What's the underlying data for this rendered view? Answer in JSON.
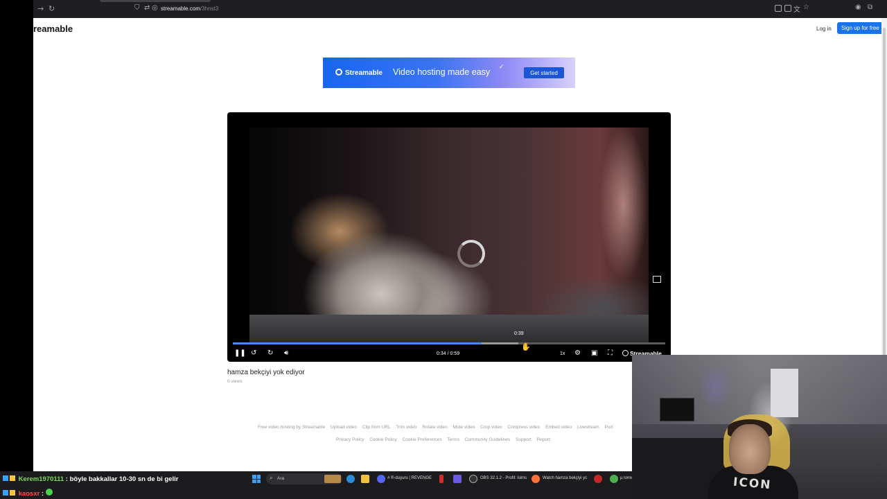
{
  "browser": {
    "url_host": "streamable.com",
    "url_path": "/3hnst3"
  },
  "header": {
    "logo": "reamable",
    "login": "Log in",
    "signup": "Sign up for free"
  },
  "banner": {
    "brand": "Streamable",
    "tagline": "Video hosting made easy",
    "cta": "Get started"
  },
  "player": {
    "hover_time": "0:39",
    "time_display": "0:34 / 0:59",
    "speed": "1x",
    "brand": "Streamable",
    "played_fraction": 0.576,
    "buffered_fraction": 0.661
  },
  "video": {
    "title": "hamza bekçiyi yok ediyor",
    "views": "0 views"
  },
  "footer": {
    "row1": [
      "Free video hosting by Streamable",
      "Upload video",
      "Clip from URL",
      "Trim video",
      "Rotate video",
      "Mute video",
      "Crop video",
      "Compress video",
      "Embed video",
      "Livestream",
      "Pod"
    ],
    "row2": [
      "Privacy Policy",
      "Cookie Policy",
      "Cookie Preferences",
      "Terms",
      "Community Guidelines",
      "Support",
      "Report"
    ]
  },
  "webcam": {
    "shirt_text": "ICON"
  },
  "chat": {
    "line1_user": "Kerem1970111",
    "line1_text": ": böyle bakkallar 10-30 sn de bi gelir",
    "line1_color": "#7ed957",
    "line2_user": "kaosxr",
    "line2_text": ":",
    "line2_color": "#ff4a4a"
  },
  "taskbar": {
    "search": "Ara",
    "discord": "# ®-duyuru | REVENGE",
    "obs": "OBS 32.1.2 - Profil: isims",
    "firefox": "Watch hamza bekçiyi yc",
    "utorrent": "µTorre"
  }
}
